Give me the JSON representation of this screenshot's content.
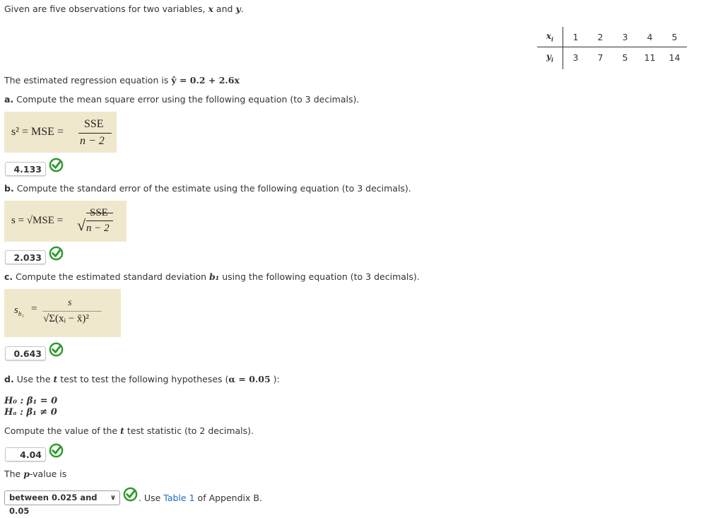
{
  "intro": {
    "text": "Given are five observations for two variables,",
    "var_x": "x",
    "and": "and",
    "var_y": "y",
    "period": "."
  },
  "observations": {
    "row_x_label": "x",
    "row_x_sub": "i",
    "row_y_label": "y",
    "row_y_sub": "i",
    "x": [
      "1",
      "2",
      "3",
      "4",
      "5"
    ],
    "y": [
      "3",
      "7",
      "5",
      "11",
      "14"
    ]
  },
  "regression": {
    "text": "The estimated regression equation is",
    "equation": "ŷ = 0.2 + 2.6x"
  },
  "part_a": {
    "label": "a.",
    "text": "Compute the mean square error using the following equation (to 3 decimals).",
    "formula_lhs": "s² = MSE =",
    "formula_num": "SSE",
    "formula_den": "n − 2",
    "answer": "4.133",
    "status": "correct"
  },
  "part_b": {
    "label": "b.",
    "text": "Compute the standard error of the estimate using the following equation (to 3 decimals).",
    "formula_lhs": "s = √MSE =",
    "formula_num": "SSE",
    "formula_den": "n − 2",
    "answer": "2.033",
    "status": "correct"
  },
  "part_c": {
    "label": "c.",
    "text_before": "Compute the estimated standard deviation",
    "symbol": "b₁",
    "text_after": "using the following equation (to 3 decimals).",
    "formula_lhs": "s",
    "formula_lhs_sub": "b₁",
    "formula_num": "s",
    "formula_den": "√Σ(xᵢ − x̄)²",
    "answer": "0.643",
    "status": "correct"
  },
  "part_d": {
    "label": "d.",
    "text_before": "Use the",
    "t": "t",
    "text_after": "test to test the following hypotheses (",
    "alpha": "α = 0.05",
    "close": " ):",
    "h0": "H₀ : β₁ = 0",
    "ha": "Hₐ : β₁ ≠ 0",
    "compute_before": "Compute the value of the",
    "compute_after": "test statistic (to 2 decimals).",
    "answer": "4.04",
    "status": "correct",
    "pvalue_before": "The",
    "pvalue_p": "p",
    "pvalue_after": "-value is",
    "pvalue_selected": "between 0.025 and 0.05",
    "pvalue_status": "correct",
    "use_text": ". Use",
    "table_link": "Table 1",
    "appendix_text": "of Appendix B."
  },
  "colors": {
    "formula_bg": "#f0e8cc",
    "check_green": "#2e9a2e",
    "link": "#1f6ec1"
  }
}
